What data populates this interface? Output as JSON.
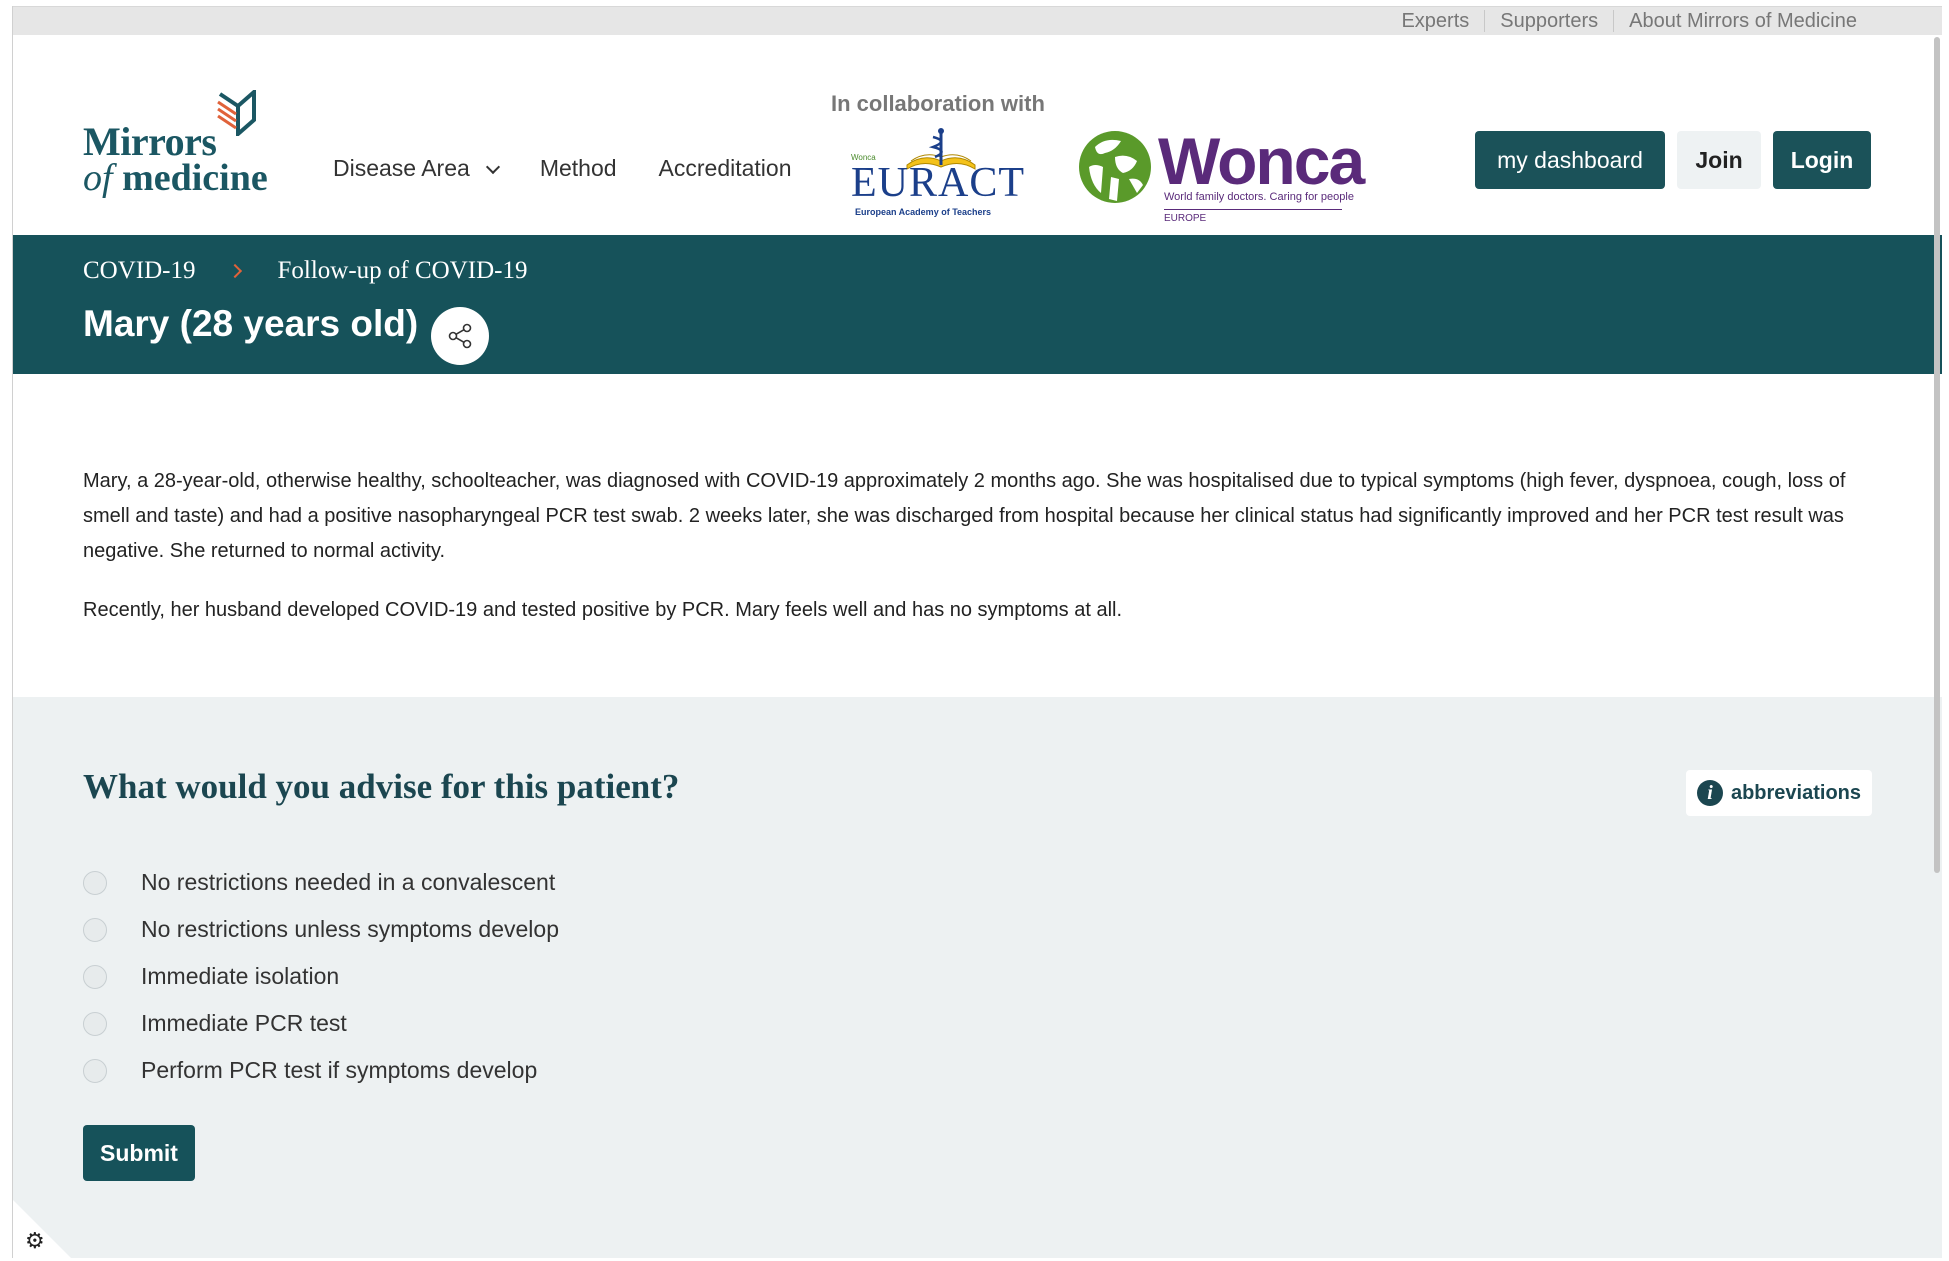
{
  "top_links": [
    "Experts",
    "Supporters",
    "About Mirrors of Medicine"
  ],
  "logo": {
    "line1": "Mirrors",
    "line2_prefix": "of",
    "line2_main": "medicine"
  },
  "nav": {
    "disease_area": "Disease Area",
    "method": "Method",
    "accreditation": "Accreditation"
  },
  "collab": {
    "label": "In collaboration with",
    "euract_name": "EURACT",
    "euract_sub": "European Academy of Teachers",
    "euract_wonca": "Wonca",
    "wonca_name": "Wonca",
    "wonca_sub": "World family doctors. Caring for people",
    "wonca_region": "EUROPE"
  },
  "auth": {
    "dashboard": "my dashboard",
    "join": "Join",
    "login": "Login"
  },
  "breadcrumb": [
    "COVID-19",
    "Follow-up of COVID-19"
  ],
  "page_title": "Mary (28 years old)",
  "case_text": [
    "Mary, a 28-year-old, otherwise healthy, schoolteacher, was diagnosed with COVID-19 approximately 2 months ago. She was hospitalised due to typical symptoms (high fever, dyspnoea, cough, loss of smell and taste) and had a positive nasopharyngeal PCR test swab. 2 weeks later, she was discharged from hospital because her clinical status had significantly improved and her PCR test result was negative. She returned to normal activity.",
    "Recently, her husband developed COVID-19 and tested positive by PCR. Mary feels well and has no symptoms at all."
  ],
  "question": "What would you advise for this patient?",
  "abbreviations_label": "abbreviations",
  "options": [
    "No restrictions needed in a convalescent",
    "No restrictions unless symptoms develop",
    "Immediate isolation",
    "Immediate PCR test",
    "Perform PCR test if symptoms develop"
  ],
  "submit_label": "Submit",
  "colors": {
    "primary": "#16525a",
    "accent": "#e0623a",
    "question_bg": "#edf1f2"
  }
}
